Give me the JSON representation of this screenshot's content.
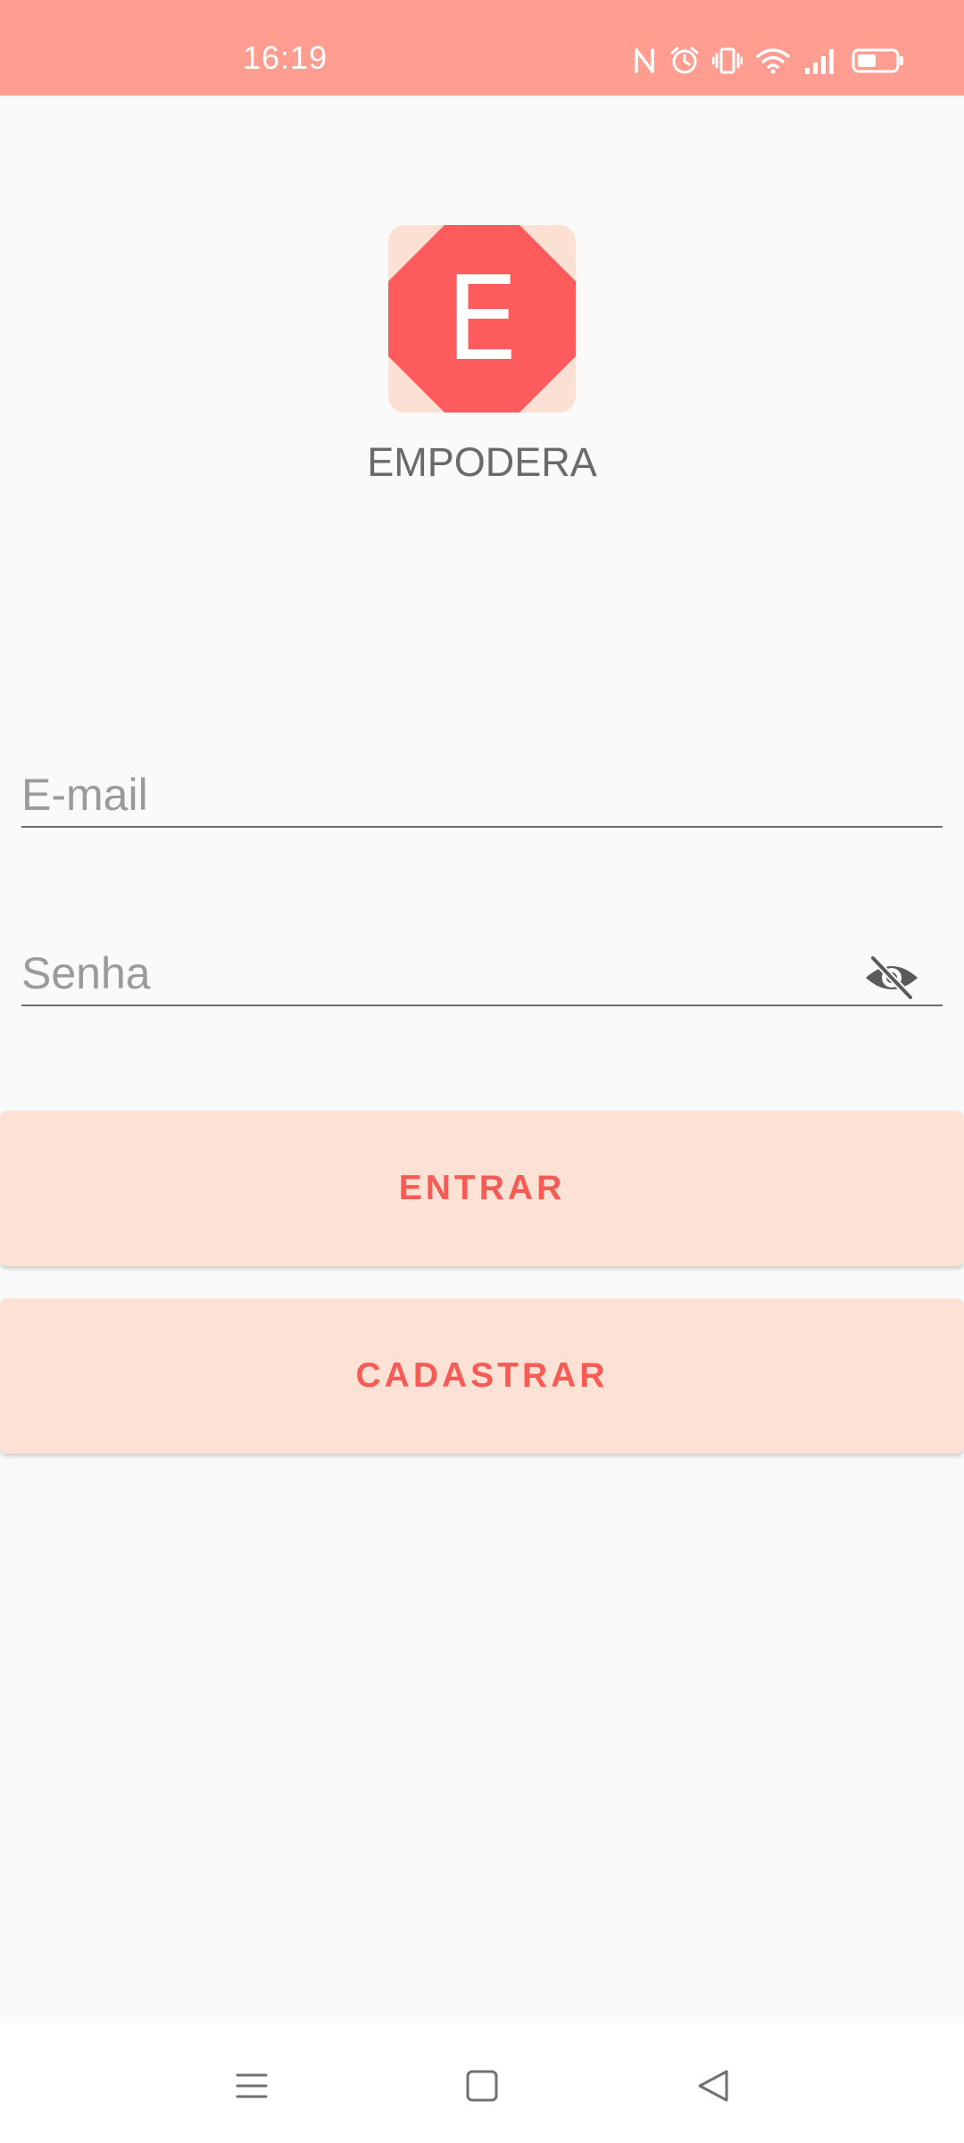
{
  "status_bar": {
    "time": "16:19",
    "icons": [
      "nfc-icon",
      "alarm-icon",
      "vibrate-icon",
      "wifi-icon",
      "signal-icon",
      "battery-icon"
    ],
    "background": "#ff9d91"
  },
  "logo": {
    "letter": "E",
    "color": "#fe5c5c"
  },
  "app_name": "EMPODERA",
  "form": {
    "email_placeholder": "E-mail",
    "password_placeholder": "Senha",
    "password_toggle_icon": "eye-off-icon"
  },
  "buttons": {
    "login_label": "ENTRAR",
    "register_label": "CADASTRAR",
    "background": "#fde1d5",
    "text_color": "#f75b56"
  },
  "nav_bar": {
    "icons": [
      "menu-icon",
      "home-icon",
      "back-icon"
    ]
  }
}
